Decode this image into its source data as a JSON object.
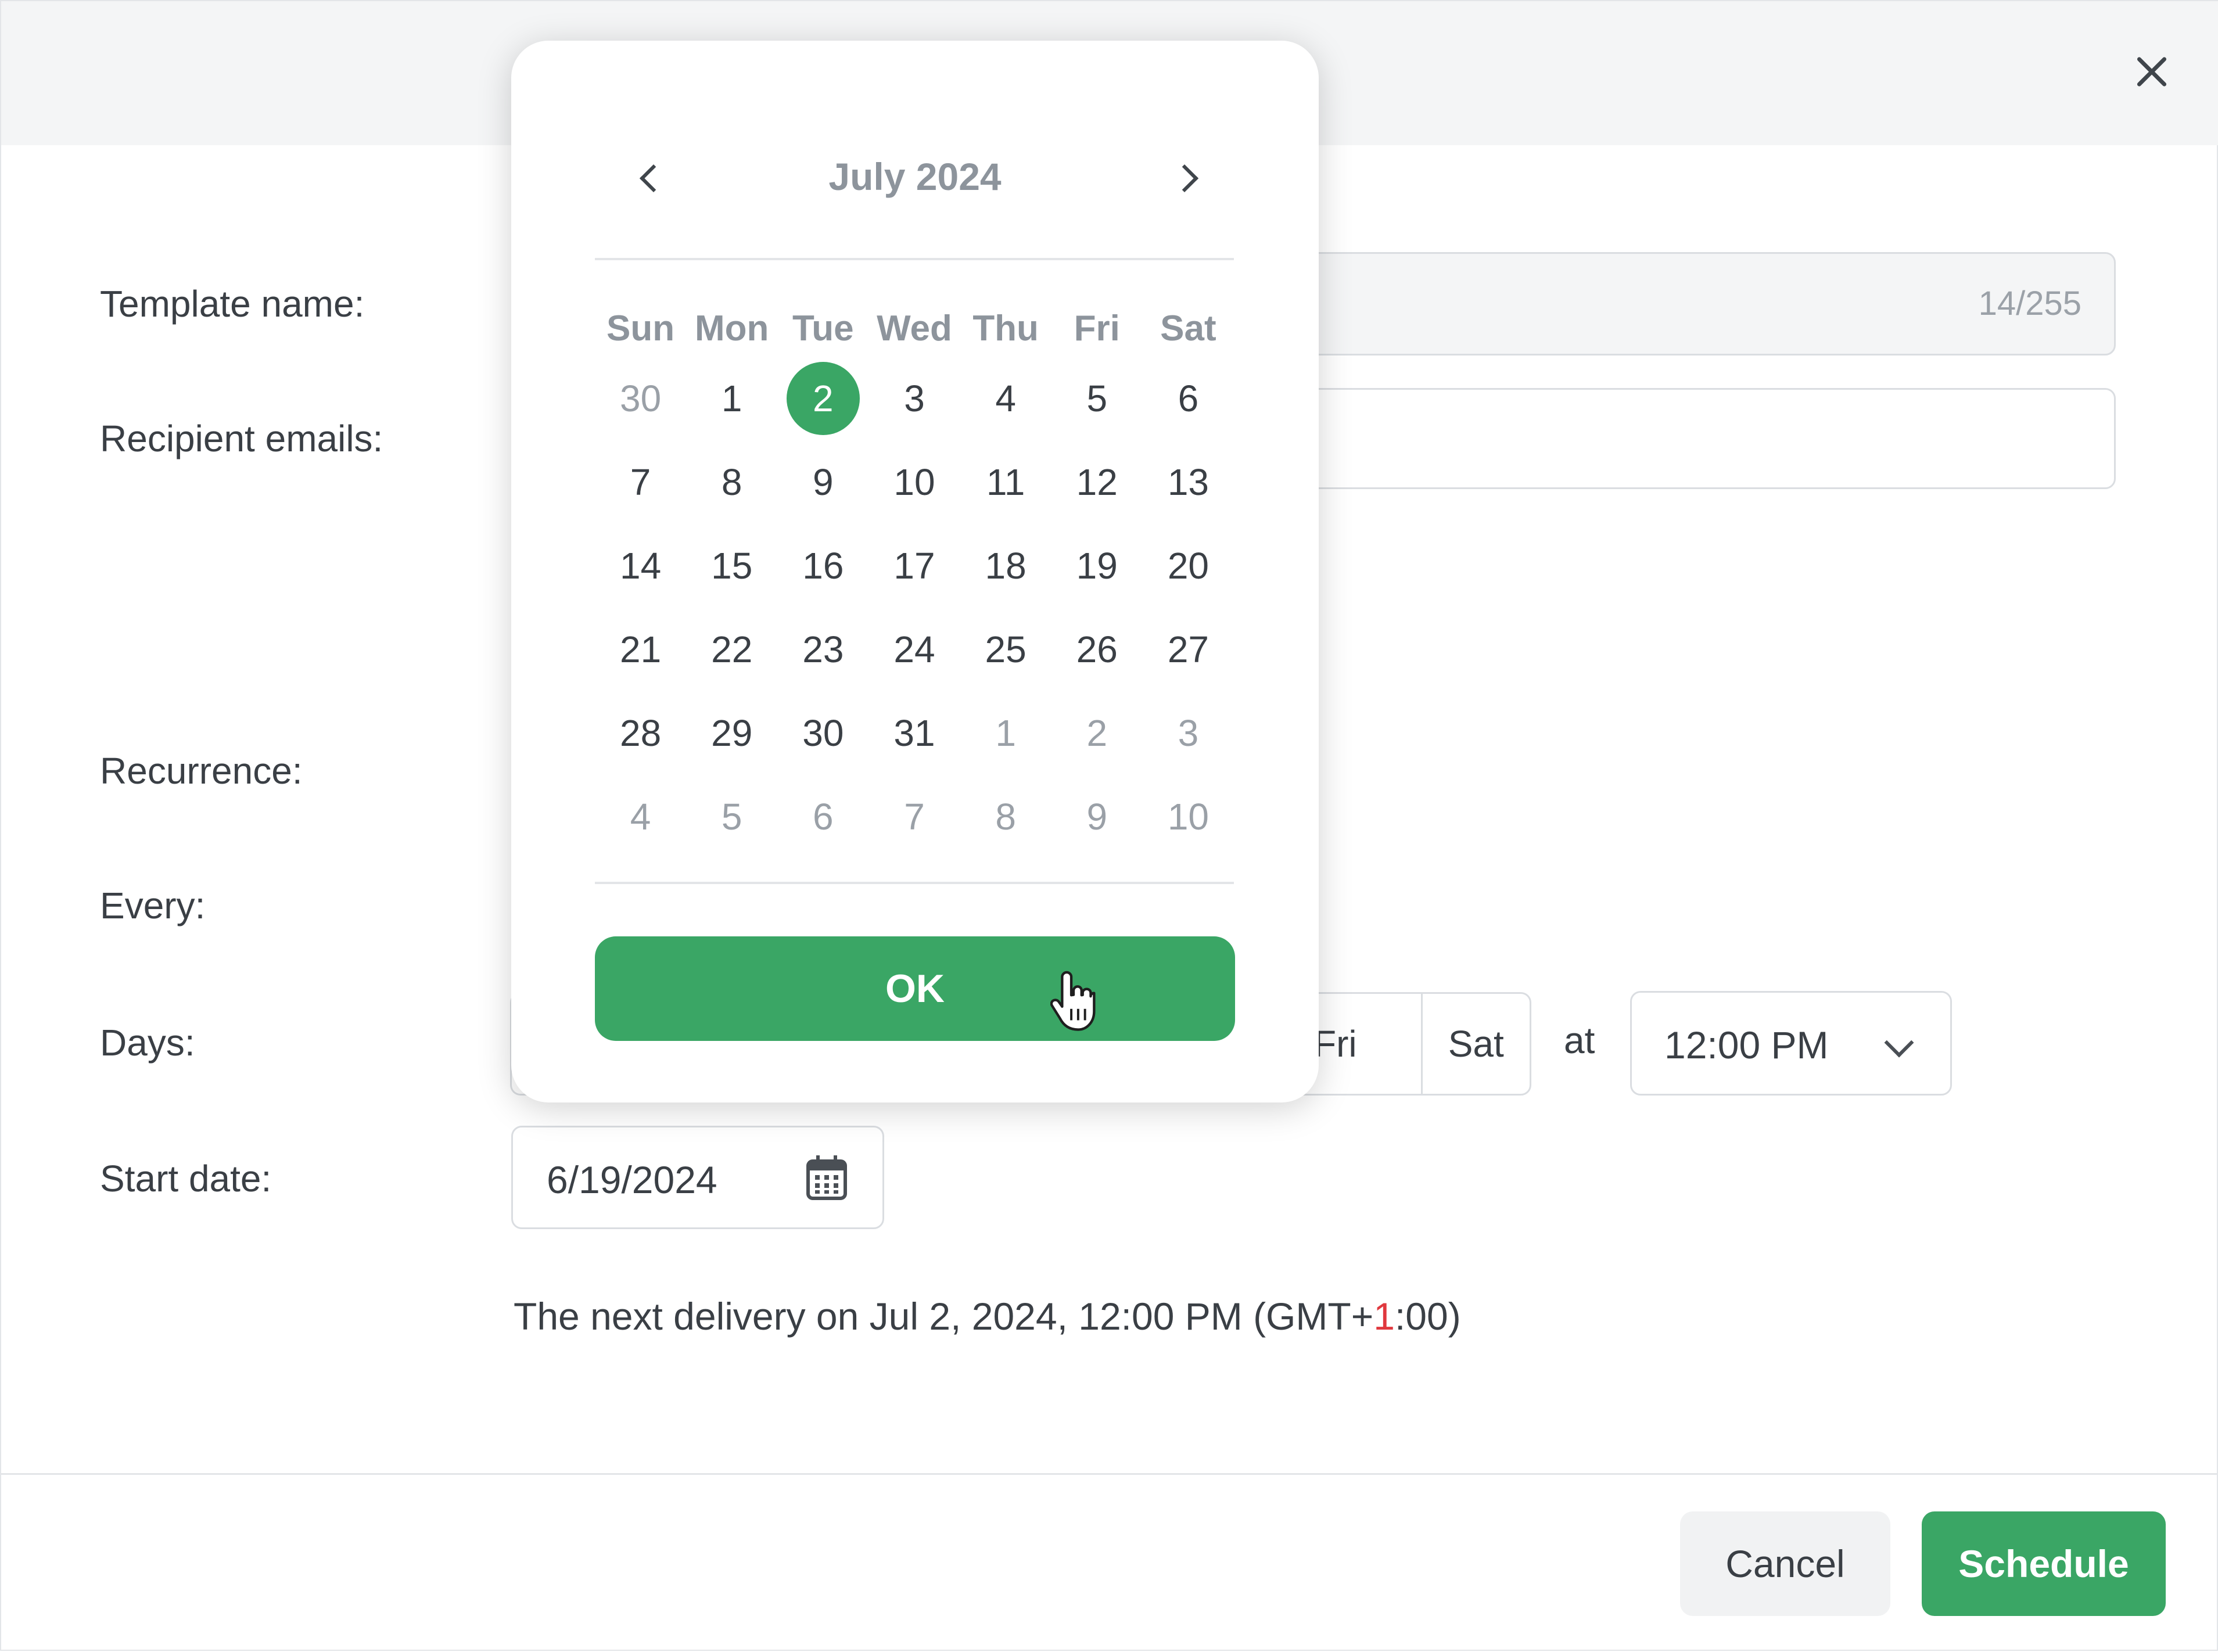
{
  "header": {
    "close_icon": "close-icon"
  },
  "form": {
    "template_name_label": "Template name:",
    "template_name_counter": "14/255",
    "recipient_emails_label": "Recipient emails:",
    "recurrence_label": "Recurrence:",
    "every_label": "Every:",
    "days_label": "Days:",
    "days_visible": [
      "Fri",
      "Sat"
    ],
    "at_label": "at",
    "time_value": "12:00 PM",
    "start_date_label": "Start date:",
    "start_date_value": "6/19/2024",
    "next_delivery_prefix": "The next delivery on Jul 2, 2024, 12:00 PM (GMT+",
    "next_delivery_red": "1",
    "next_delivery_suffix": ":00)"
  },
  "footer": {
    "cancel_label": "Cancel",
    "schedule_label": "Schedule"
  },
  "datepicker": {
    "month_label": "July 2024",
    "weekdays": [
      "Sun",
      "Mon",
      "Tue",
      "Wed",
      "Thu",
      "Fri",
      "Sat"
    ],
    "days": [
      {
        "d": "30",
        "muted": true
      },
      {
        "d": "1"
      },
      {
        "d": "2",
        "selected": true
      },
      {
        "d": "3"
      },
      {
        "d": "4"
      },
      {
        "d": "5"
      },
      {
        "d": "6"
      },
      {
        "d": "7"
      },
      {
        "d": "8"
      },
      {
        "d": "9"
      },
      {
        "d": "10"
      },
      {
        "d": "11"
      },
      {
        "d": "12"
      },
      {
        "d": "13"
      },
      {
        "d": "14"
      },
      {
        "d": "15"
      },
      {
        "d": "16"
      },
      {
        "d": "17"
      },
      {
        "d": "18"
      },
      {
        "d": "19"
      },
      {
        "d": "20"
      },
      {
        "d": "21"
      },
      {
        "d": "22"
      },
      {
        "d": "23"
      },
      {
        "d": "24"
      },
      {
        "d": "25"
      },
      {
        "d": "26"
      },
      {
        "d": "27"
      },
      {
        "d": "28"
      },
      {
        "d": "29"
      },
      {
        "d": "30"
      },
      {
        "d": "31"
      },
      {
        "d": "1",
        "muted": true
      },
      {
        "d": "2",
        "muted": true
      },
      {
        "d": "3",
        "muted": true
      },
      {
        "d": "4",
        "muted": true
      },
      {
        "d": "5",
        "muted": true
      },
      {
        "d": "6",
        "muted": true
      },
      {
        "d": "7",
        "muted": true
      },
      {
        "d": "8",
        "muted": true
      },
      {
        "d": "9",
        "muted": true
      },
      {
        "d": "10",
        "muted": true
      }
    ],
    "ok_label": "OK"
  },
  "colors": {
    "accent": "#3aa665",
    "muted_text": "#9aa0a7",
    "highlight_red": "#e0383e"
  }
}
